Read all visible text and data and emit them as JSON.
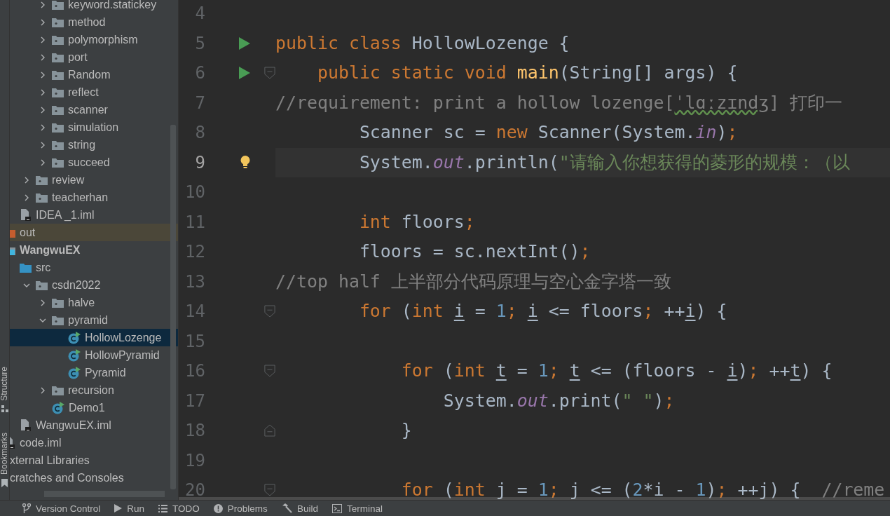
{
  "tool_stripe": [
    {
      "label": "Structure",
      "kind": "structure"
    },
    {
      "label": "Bookmarks",
      "kind": "bookmarks"
    }
  ],
  "project_tree": [
    {
      "children": [
        {
          "children": [
            {
              "children": [
                {
                  "label": "keyword.statickey",
                  "kind": "package",
                  "expanded": false,
                  "selected": false
                },
                {
                  "label": "method",
                  "kind": "package",
                  "expanded": false,
                  "selected": false
                },
                {
                  "label": "polymorphism",
                  "kind": "package",
                  "expanded": false,
                  "selected": false
                },
                {
                  "label": "port",
                  "kind": "package",
                  "expanded": false,
                  "selected": false
                },
                {
                  "label": "Random",
                  "kind": "package",
                  "expanded": false,
                  "selected": false
                },
                {
                  "label": "reflect",
                  "kind": "package",
                  "expanded": false,
                  "selected": false
                },
                {
                  "label": "scanner",
                  "kind": "package",
                  "expanded": false,
                  "selected": false
                },
                {
                  "label": "simulation",
                  "kind": "package",
                  "expanded": false,
                  "selected": false
                },
                {
                  "label": "string",
                  "kind": "package",
                  "expanded": false,
                  "selected": false
                },
                {
                  "label": "succeed",
                  "kind": "package",
                  "expanded": false,
                  "selected": false
                }
              ]
            },
            {
              "label": "review",
              "kind": "package",
              "expanded": false,
              "selected": false
            },
            {
              "label": "teacherhan",
              "kind": "package",
              "expanded": false,
              "selected": false
            }
          ]
        },
        {
          "label": "IDEA _1.iml",
          "kind": "module-file",
          "selected": false
        }
      ]
    },
    {
      "label": "out",
      "kind": "excluded",
      "selected": false
    },
    {
      "label": "WangwuEX",
      "kind": "module",
      "selected": false,
      "children": [
        {
          "label": "src",
          "kind": "source-root",
          "selected": false,
          "children": [
            {
              "label": "csdn2022",
              "kind": "package",
              "expanded": true,
              "selected": false,
              "children": [
                {
                  "label": "halve",
                  "kind": "package",
                  "expanded": false,
                  "selected": false
                },
                {
                  "label": "pyramid",
                  "kind": "package",
                  "expanded": true,
                  "selected": false,
                  "children": [
                    {
                      "label": "HollowLozenge",
                      "kind": "class",
                      "selected": true
                    },
                    {
                      "label": "HollowPyramid",
                      "kind": "class",
                      "selected": false
                    },
                    {
                      "label": "Pyramid",
                      "kind": "class",
                      "selected": false
                    }
                  ]
                },
                {
                  "label": "recursion",
                  "kind": "package",
                  "expanded": false,
                  "selected": false
                },
                {
                  "label": "Demo1",
                  "kind": "class",
                  "selected": false
                }
              ]
            }
          ]
        },
        {
          "label": "WangwuEX.iml",
          "kind": "module-file",
          "selected": false
        }
      ]
    },
    {
      "label": "code.iml",
      "kind": "module-file",
      "selected": false
    },
    {
      "label": "xternal Libraries",
      "kind": "library",
      "selected": false
    },
    {
      "label": "cratches and Consoles",
      "kind": "library",
      "selected": false
    }
  ],
  "editor": {
    "lines": [
      {
        "number": "4"
      },
      {
        "number": "5",
        "gutter": {
          "kind": "run"
        },
        "tokens": [
          {
            "text": "public class ",
            "kind": "keyword"
          },
          {
            "text": "HollowLozenge {",
            "kind": "plain"
          }
        ]
      },
      {
        "number": "6",
        "gutter": {
          "kind": "run"
        },
        "fold": {
          "kind": "start"
        },
        "tokens": [
          {
            "text": "    public static void ",
            "kind": "keyword"
          },
          {
            "text": "main",
            "kind": "method"
          },
          {
            "text": "(String[] args) {",
            "kind": "plain"
          }
        ]
      },
      {
        "number": "7",
        "tokens": [
          {
            "text": "//requirement: print a hollow lozenge[",
            "kind": "comment"
          },
          {
            "text": "ˈlɑːzɪndʒ",
            "kind": "typo"
          },
          {
            "text": "] 打印一",
            "kind": "comment"
          }
        ]
      },
      {
        "number": "8",
        "tokens": [
          {
            "text": "        Scanner sc = ",
            "kind": "plain"
          },
          {
            "text": "new ",
            "kind": "keyword"
          },
          {
            "text": "Scanner(System.",
            "kind": "plain"
          },
          {
            "text": "in",
            "kind": "static"
          },
          {
            "text": ")",
            "kind": "plain"
          },
          {
            "text": ";",
            "kind": "keyword"
          }
        ]
      },
      {
        "number": "9",
        "current": true,
        "gutter": {
          "kind": "bulb"
        },
        "tokens": [
          {
            "text": "        System.",
            "kind": "plain"
          },
          {
            "text": "out",
            "kind": "static"
          },
          {
            "text": ".println(",
            "kind": "plain"
          },
          {
            "text": "\"请输入你想获得的菱形的规模：（以",
            "kind": "string"
          }
        ]
      },
      {
        "number": "10"
      },
      {
        "number": "11",
        "tokens": [
          {
            "text": "        int ",
            "kind": "keyword"
          },
          {
            "text": "floors",
            "kind": "plain"
          },
          {
            "text": ";",
            "kind": "keyword"
          }
        ]
      },
      {
        "number": "12",
        "tokens": [
          {
            "text": "        floors = sc.nextInt()",
            "kind": "plain"
          },
          {
            "text": ";",
            "kind": "keyword"
          }
        ]
      },
      {
        "number": "13",
        "tokens": [
          {
            "text": "//top half 上半部分代码原理与空心金字塔一致",
            "kind": "comment"
          }
        ]
      },
      {
        "number": "14",
        "fold": {
          "kind": "start"
        },
        "tokens": [
          {
            "text": "        for ",
            "kind": "keyword"
          },
          {
            "text": "(",
            "kind": "plain"
          },
          {
            "text": "int ",
            "kind": "keyword"
          },
          {
            "text": "i",
            "kind": "var"
          },
          {
            "text": " = ",
            "kind": "plain"
          },
          {
            "text": "1",
            "kind": "number"
          },
          {
            "text": "; ",
            "kind": "keyword"
          },
          {
            "text": "i",
            "kind": "var"
          },
          {
            "text": " <= floors",
            "kind": "plain"
          },
          {
            "text": "; ",
            "kind": "keyword"
          },
          {
            "text": "++",
            "kind": "plain"
          },
          {
            "text": "i",
            "kind": "var"
          },
          {
            "text": ") {",
            "kind": "plain"
          }
        ]
      },
      {
        "number": "15"
      },
      {
        "number": "16",
        "fold": {
          "kind": "start"
        },
        "tokens": [
          {
            "text": "            for ",
            "kind": "keyword"
          },
          {
            "text": "(",
            "kind": "plain"
          },
          {
            "text": "int ",
            "kind": "keyword"
          },
          {
            "text": "t",
            "kind": "var"
          },
          {
            "text": " = ",
            "kind": "plain"
          },
          {
            "text": "1",
            "kind": "number"
          },
          {
            "text": "; ",
            "kind": "keyword"
          },
          {
            "text": "t",
            "kind": "var"
          },
          {
            "text": " <= (floors - ",
            "kind": "plain"
          },
          {
            "text": "i",
            "kind": "var"
          },
          {
            "text": ")",
            "kind": "plain"
          },
          {
            "text": "; ",
            "kind": "keyword"
          },
          {
            "text": "++",
            "kind": "plain"
          },
          {
            "text": "t",
            "kind": "var"
          },
          {
            "text": ") {",
            "kind": "plain"
          }
        ]
      },
      {
        "number": "17",
        "tokens": [
          {
            "text": "                System.",
            "kind": "plain"
          },
          {
            "text": "out",
            "kind": "static"
          },
          {
            "text": ".print(",
            "kind": "plain"
          },
          {
            "text": "\" \"",
            "kind": "string"
          },
          {
            "text": ")",
            "kind": "plain"
          },
          {
            "text": ";",
            "kind": "keyword"
          }
        ]
      },
      {
        "number": "18",
        "fold": {
          "kind": "end"
        },
        "tokens": [
          {
            "text": "            }",
            "kind": "plain"
          }
        ]
      },
      {
        "number": "19"
      },
      {
        "number": "20",
        "fold": {
          "kind": "start"
        },
        "tokens": [
          {
            "text": "            for ",
            "kind": "keyword"
          },
          {
            "text": "(",
            "kind": "plain"
          },
          {
            "text": "int ",
            "kind": "keyword"
          },
          {
            "text": "j = ",
            "kind": "plain"
          },
          {
            "text": "1",
            "kind": "number"
          },
          {
            "text": "; ",
            "kind": "keyword"
          },
          {
            "text": "j <= (",
            "kind": "plain"
          },
          {
            "text": "2",
            "kind": "number"
          },
          {
            "text": "*i - ",
            "kind": "plain"
          },
          {
            "text": "1",
            "kind": "number"
          },
          {
            "text": ")",
            "kind": "plain"
          },
          {
            "text": "; ",
            "kind": "keyword"
          },
          {
            "text": "++j) {  ",
            "kind": "plain"
          },
          {
            "text": "//reme",
            "kind": "comment"
          }
        ]
      }
    ]
  },
  "bottom_bar": [
    {
      "label": "Version Control",
      "kind": "vcs"
    },
    {
      "label": "Run",
      "kind": "run"
    },
    {
      "label": "TODO",
      "kind": "todo"
    },
    {
      "label": "Problems",
      "kind": "problems"
    },
    {
      "label": "Build",
      "kind": "build"
    },
    {
      "label": "Terminal",
      "kind": "terminal"
    }
  ]
}
